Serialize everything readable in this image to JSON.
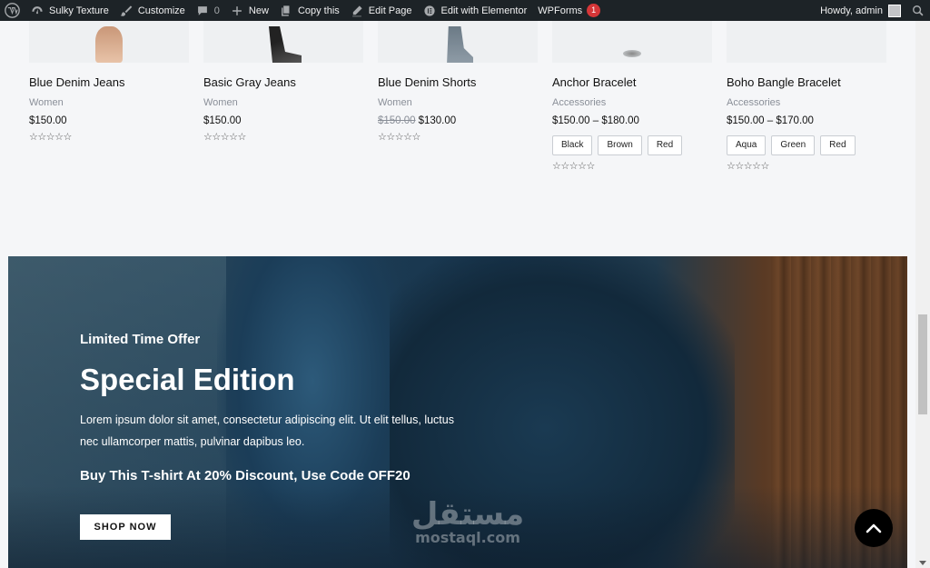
{
  "admin_bar": {
    "site_name": "Sulky Texture",
    "customize": "Customize",
    "comments_count": "0",
    "new": "New",
    "copy": "Copy this",
    "edit_page": "Edit Page",
    "elementor": "Edit with Elementor",
    "wpforms": "WPForms",
    "wpforms_badge": "1",
    "howdy": "Howdy, admin"
  },
  "products": [
    {
      "title": "Blue Denim Jeans",
      "category": "Women",
      "price": "$150.00",
      "old_price": "",
      "stars": "☆☆☆☆☆",
      "swatches": []
    },
    {
      "title": "Basic Gray Jeans",
      "category": "Women",
      "price": "$150.00",
      "old_price": "",
      "stars": "☆☆☆☆☆",
      "swatches": []
    },
    {
      "title": "Blue Denim Shorts",
      "category": "Women",
      "price": "$130.00",
      "old_price": "$150.00",
      "stars": "☆☆☆☆☆",
      "swatches": []
    },
    {
      "title": "Anchor Bracelet",
      "category": "Accessories",
      "price": "$150.00 – $180.00",
      "old_price": "",
      "stars": "☆☆☆☆☆",
      "swatches": [
        "Black",
        "Brown",
        "Red"
      ]
    },
    {
      "title": "Boho Bangle Bracelet",
      "category": "Accessories",
      "price": "$150.00 – $170.00",
      "old_price": "",
      "stars": "☆☆☆☆☆",
      "swatches": [
        "Aqua",
        "Green",
        "Red"
      ]
    }
  ],
  "banner": {
    "eyebrow": "Limited Time Offer",
    "headline": "Special Edition",
    "body": "Lorem ipsum dolor sit amet, consectetur adipiscing elit. Ut elit tellus, luctus nec ullamcorper mattis, pulvinar dapibus leo.",
    "promo": "Buy This T-shirt At 20% Discount, Use Code OFF20",
    "cta": "SHOP NOW"
  },
  "watermark": {
    "arabic": "مستقل",
    "latin": "mostaql.com"
  },
  "colors": {
    "admin_bar": "#1d2327",
    "badge": "#d63638",
    "page_bg": "#f5f6f8",
    "banner_primary": "#17344c"
  }
}
